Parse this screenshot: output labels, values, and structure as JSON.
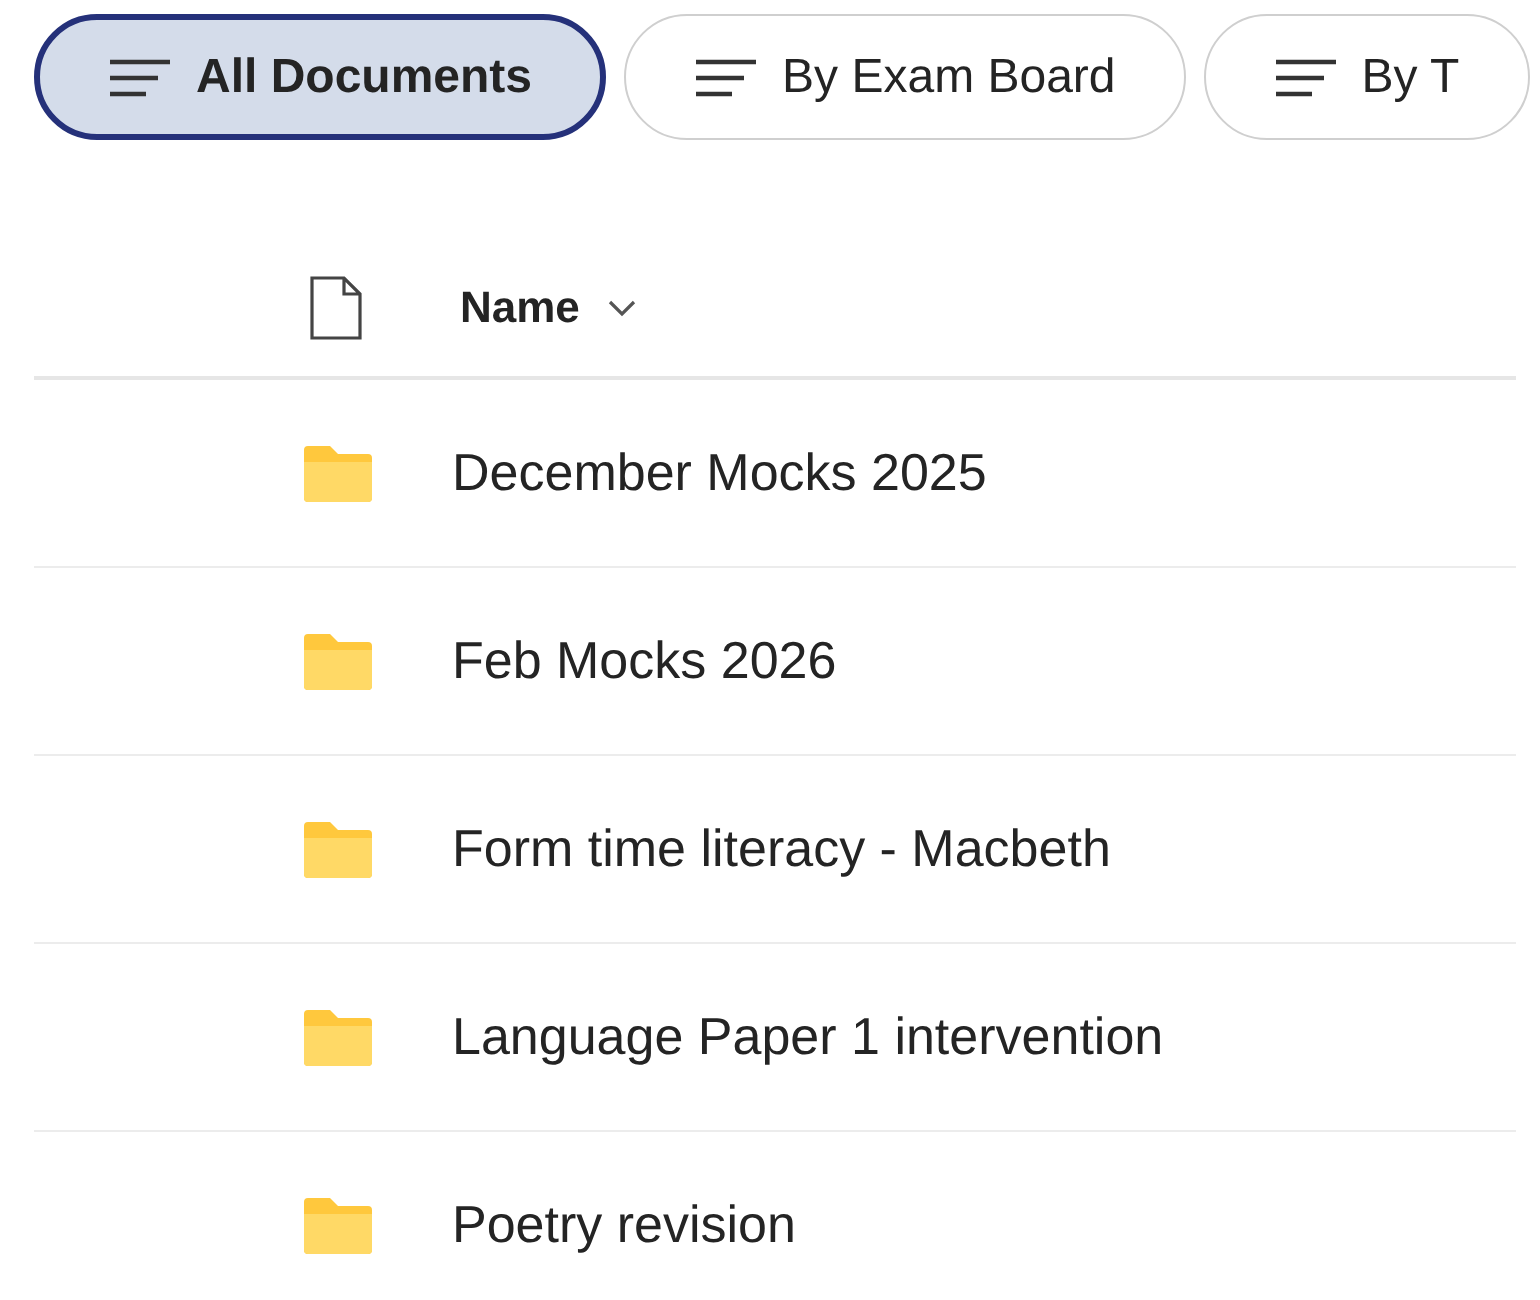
{
  "view_tabs": [
    {
      "label": "All Documents",
      "selected": true
    },
    {
      "label": "By Exam Board",
      "selected": false
    },
    {
      "label": "By T",
      "selected": false
    }
  ],
  "table": {
    "columns": [
      {
        "label": "Name",
        "sorted": true
      }
    ],
    "rows": [
      {
        "name": "December Mocks 2025",
        "kind": "folder"
      },
      {
        "name": "Feb Mocks 2026",
        "kind": "folder"
      },
      {
        "name": "Form time literacy - Macbeth",
        "kind": "folder"
      },
      {
        "name": "Language Paper 1 intervention",
        "kind": "folder"
      },
      {
        "name": "Poetry revision",
        "kind": "folder"
      }
    ]
  }
}
